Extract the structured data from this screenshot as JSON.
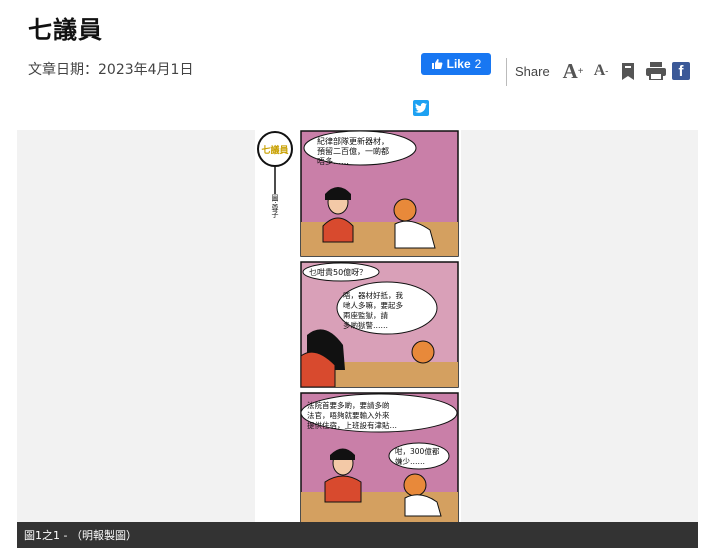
{
  "article": {
    "title": "七議員",
    "date": "文章日期：2023年4月1日"
  },
  "social": {
    "like_label": "Like",
    "like_count": "2",
    "share_label": "Share",
    "font_up": "A",
    "font_down": "A"
  },
  "comic": {
    "series_title": "七議員",
    "author": "圖‧尊子",
    "panels": [
      {
        "speech": [
          "紀律部隊更新器材，",
          "預留二百億，一啲都",
          "唔多……"
        ]
      },
      {
        "speech_left": "乜咁貴50億呀？",
        "speech_right": [
          "唔，器材好抵，我",
          "哋人多嘛，要起多",
          "兩座監獄，請",
          "多啲獄警……"
        ]
      },
      {
        "speech": [
          "法院首要多啲，要請多啲",
          "法官，唔夠就要輸入外來",
          "提供住宿，上班設有津貼…"
        ],
        "speech_right": [
          "咁，300億都",
          "嫌少……"
        ]
      }
    ]
  },
  "caption": "圖1之1 - （明報製圖）",
  "colors": {
    "facebook": "#1877f2",
    "twitter": "#1da1f2",
    "caption_bg": "#333333",
    "panel_bg": "#d9a0b8"
  }
}
